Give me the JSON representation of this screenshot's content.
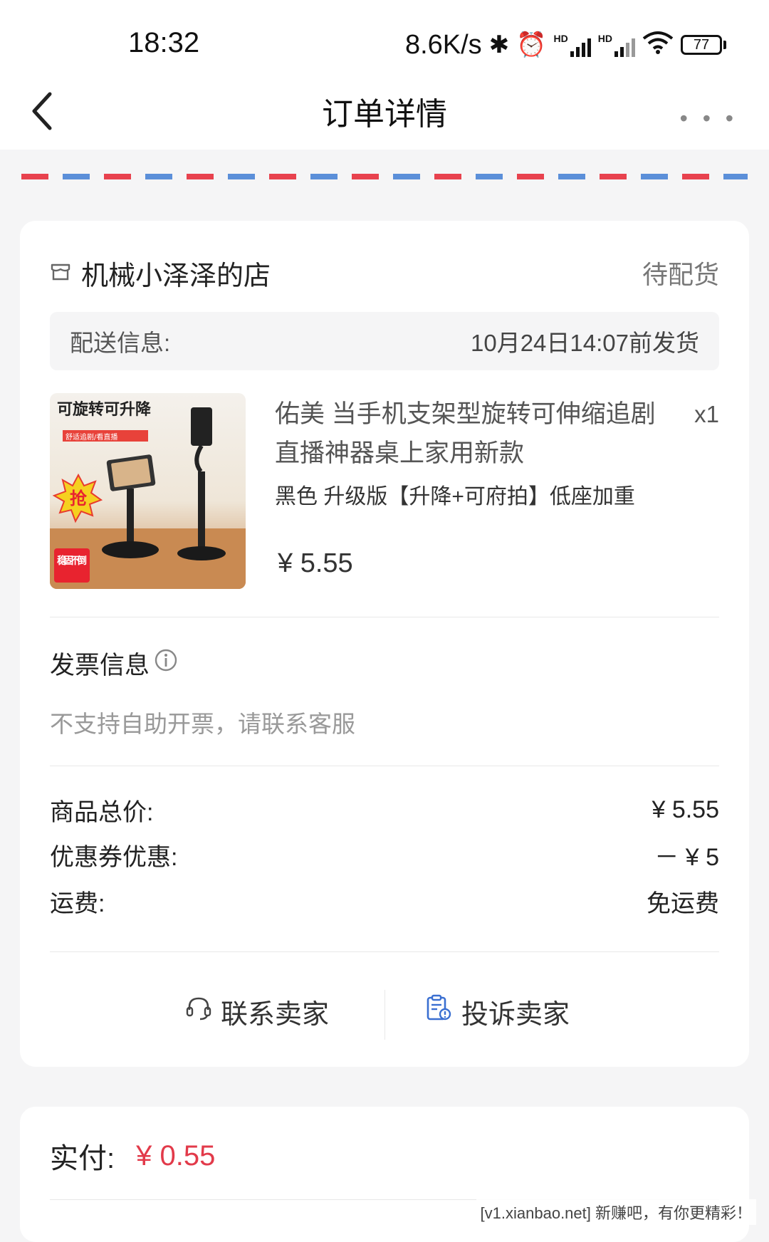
{
  "status_bar": {
    "time": "18:32",
    "net_speed": "8.6K/s",
    "battery": "77",
    "signal_label": "HD"
  },
  "nav": {
    "title": "订单详情"
  },
  "order": {
    "shop_name": "机械小泽泽的店",
    "status": "待配货",
    "delivery_label": "配送信息:",
    "delivery_time": "10月24日14:07前发货",
    "product": {
      "title": "佑美 当手机支架型旋转可伸缩追剧直播神器桌上家用新款",
      "quantity": "x1",
      "spec": "黑色 升级版【升降+可府拍】低座加重",
      "price": "¥ 5.55",
      "image_texts": {
        "headline": "可旋转可升降",
        "sub": "舒适追剧/看直播",
        "badge": "抢",
        "corner": "稳固不倒"
      }
    },
    "invoice": {
      "title": "发票信息",
      "note": "不支持自助开票，请联系客服"
    },
    "fees": [
      {
        "label": "商品总价:",
        "value": "¥ 5.55"
      },
      {
        "label": "优惠券优惠:",
        "value": "－ ¥ 5"
      },
      {
        "label": "运费:",
        "value": "免运费"
      }
    ],
    "actions": {
      "contact": "联系卖家",
      "complain": "投诉卖家"
    },
    "payment": {
      "label": "实付:",
      "amount": "¥ 0.55"
    }
  },
  "watermark": "[v1.xianbao.net] 新赚吧，有你更精彩！",
  "colors": {
    "accent_red": "#e23a4a",
    "stripe_red": "#e8424e",
    "stripe_blue": "#5b8fd9",
    "complain_blue": "#3a6fd1"
  }
}
